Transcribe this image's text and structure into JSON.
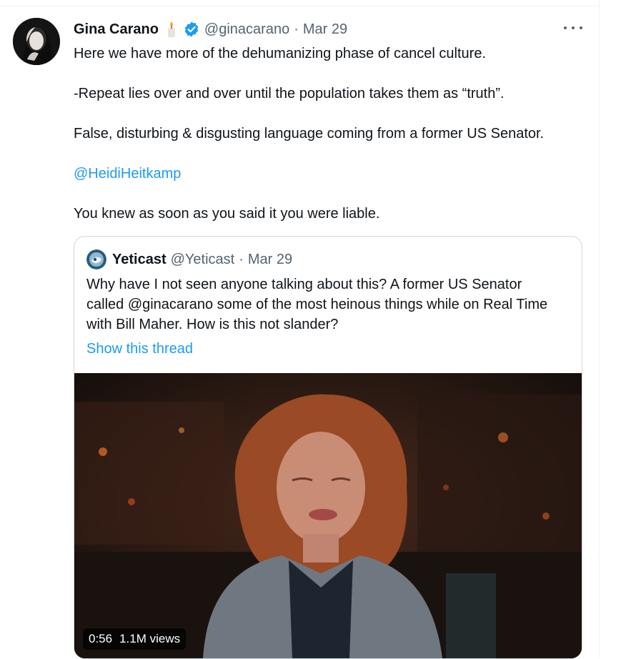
{
  "tweet": {
    "author_name": "Gina Carano",
    "handle": "@ginacarano",
    "separator": "·",
    "date": "Mar 29",
    "lines": [
      "Here we have more of the dehumanizing phase of cancel culture.",
      "-Repeat lies over and over until the population takes them as “truth”.",
      "False, disturbing & disgusting language coming from a former US Senator.",
      "@HeidiHeitkamp",
      "You knew as soon as you said it you were liable."
    ]
  },
  "quoted_tweet": {
    "author_name": "Yeticast",
    "handle": "@Yeticast",
    "separator": "·",
    "date": "Mar 29",
    "lines": [
      "Why have I not seen anyone talking about this? A former US Senator",
      "called @ginacarano some of the most heinous things while on Real Time",
      "with Bill Maher. How is this not slander?"
    ],
    "show_thread": "Show this thread",
    "video": {
      "duration": "0:56",
      "views": "1.1M views"
    }
  },
  "colors": {
    "link": "#1d9bf0",
    "verified": "#1d9bf0",
    "secondary_text": "#536471",
    "border": "#cfd9de"
  },
  "icons": [
    "candle-emoji-icon",
    "verified-badge-icon",
    "more-options-icon"
  ]
}
